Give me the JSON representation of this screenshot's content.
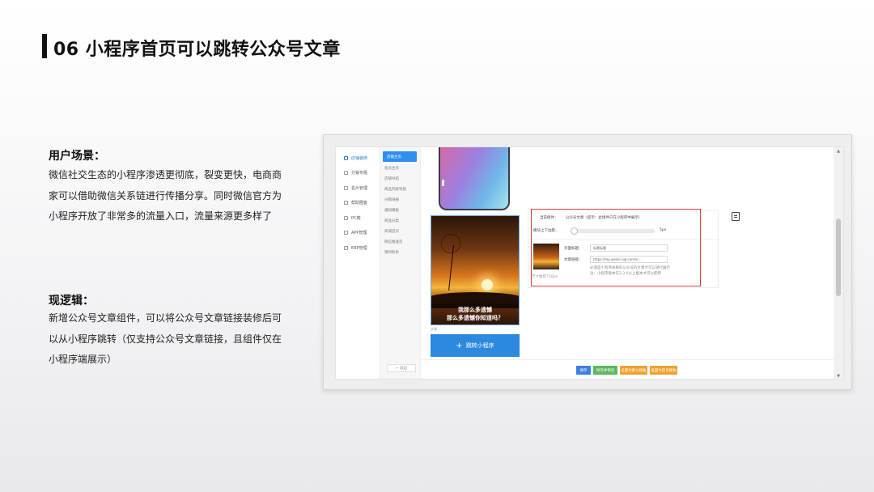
{
  "slide": {
    "title": "06 小程序首页可以跳转公众号文章"
  },
  "scenario": {
    "heading": "用户场景：",
    "body": "微信社交生态的小程序渗透更彻底，裂变更快，电商商家可以借助微信关系链进行传播分享。同时微信官方为小程序开放了非常多的流量入口，流量来源更多样了"
  },
  "logic": {
    "heading": "现逻辑：",
    "body": "新增公众号文章组件，可以将公众号文章链接装修后可以从小程序跳转（仅支持公众号文章链接，且组件仅在小程序端展示）"
  },
  "app": {
    "nav1": [
      {
        "label": "店铺装修",
        "icon": "page-icon",
        "active": true
      },
      {
        "label": "分销专题",
        "icon": "share-icon"
      },
      {
        "label": "名片管理",
        "icon": "card-icon"
      },
      {
        "label": "帮助圈客",
        "icon": "help-icon"
      },
      {
        "label": "PC端",
        "icon": "pc-icon"
      },
      {
        "label": "APP管理",
        "icon": "app-icon"
      },
      {
        "label": "ERP管理",
        "icon": "erp-icon"
      }
    ],
    "nav2": [
      {
        "label": "店铺主页",
        "active": true
      },
      {
        "label": "会员主页"
      },
      {
        "label": "店铺导航"
      },
      {
        "label": "商品列表导航"
      },
      {
        "label": "分销海报"
      },
      {
        "label": "通知模板"
      },
      {
        "label": "商品分类"
      },
      {
        "label": "商城首页"
      },
      {
        "label": "微信推送页"
      },
      {
        "label": "限时秒杀"
      }
    ],
    "back_label": "← 收起",
    "article_caption_line1": "我那么多遗憾",
    "article_caption_line2": "那么多遗憾你知道吗？",
    "article_tiny_label": "文章",
    "jump_button": "跳转小程序",
    "prop": {
      "current_component_label": "当前组件：",
      "current_component_value": "公众号文章（提示：此组件只在小程序中展示）",
      "margin_label": "模块上下边距：",
      "margin_value": "5px",
      "title_label": "页面标题：",
      "title_value": "标题标题",
      "link_label": "文章链接：",
      "link_value": "https://mp.weixin.qq.com/s/...",
      "note_line1": "必须是小程序关联的公众号的文章才可以进行展示",
      "note_line2": "注：小程序版本在2.3.0以上版本才可以使用",
      "thumb_hint": "尺寸推荐750px"
    },
    "footer_buttons": [
      {
        "label": "保存",
        "color": "#3b7fe0"
      },
      {
        "label": "保存并预览",
        "color": "#5cb85c"
      },
      {
        "label": "设置为默认模板",
        "color": "#f0a030"
      },
      {
        "label": "设置为首页模板",
        "color": "#f0a030"
      }
    ]
  }
}
